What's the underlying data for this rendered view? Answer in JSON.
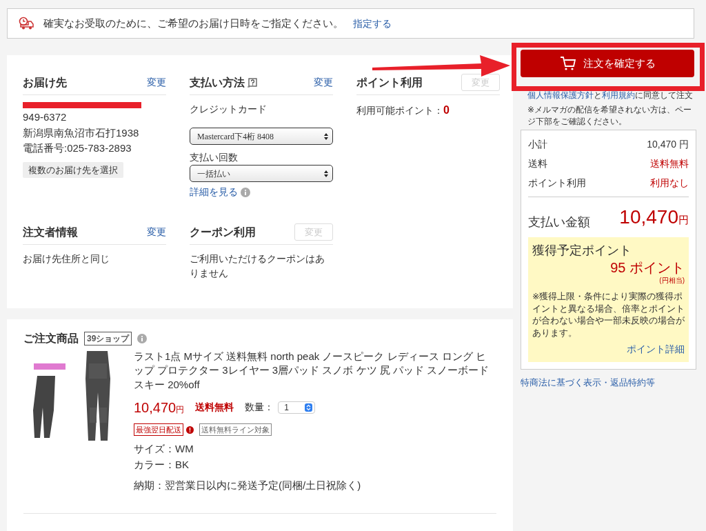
{
  "banner": {
    "text": "確実なお受取のために、ご希望のお届け日時をご指定ください。",
    "link": "指定する"
  },
  "sections": [
    {
      "kind": "address",
      "title": "お届け先",
      "change": {
        "label": "変更",
        "disabled": false
      },
      "lines": [
        "949-6372",
        "新潟県南魚沼市石打1938",
        "電話番号:025-783-2893"
      ],
      "button": "複数のお届け先を選択"
    },
    {
      "kind": "payment",
      "title": "支払い方法",
      "change": {
        "label": "変更",
        "disabled": false
      },
      "method": "クレジットカード",
      "card": "Mastercard下4桁 8408",
      "installments_label": "支払い回数",
      "installments": "一括払い",
      "details_link": "詳細を見る"
    },
    {
      "kind": "points",
      "title": "ポイント利用",
      "change": {
        "label": "変更",
        "disabled": true
      },
      "label": "利用可能ポイント：",
      "value": "0"
    },
    {
      "kind": "text",
      "title": "注文者情報",
      "change": {
        "label": "変更",
        "disabled": false
      },
      "text": "お届け先住所と同じ"
    },
    {
      "kind": "text",
      "title": "クーポン利用",
      "change": {
        "label": "変更",
        "disabled": true
      },
      "text": "ご利用いただけるクーポンはありません"
    }
  ],
  "order": {
    "title": "ご注文商品",
    "shop": "39ショップ",
    "product": {
      "name": "ラスト1点 Mサイズ 送料無料 north peak ノースピーク レディース ロング ヒップ プロテクター 3レイヤー 3層パッド スノボ ケツ 尻 パッド スノーボードスキー 20%off",
      "price": "10,470",
      "yen": "円",
      "shipping": "送料無料",
      "qty_label": "数量：",
      "qty": "1",
      "tags": [
        {
          "label": "最強翌日配送",
          "kind": "red"
        },
        {
          "label": "送料無料ライン対象",
          "kind": "gray"
        }
      ],
      "attributes": [
        "サイズ：WM",
        "カラー：BK"
      ],
      "delivery": "納期：翌営業日以内に発送予定(同梱/土日祝除く)"
    }
  },
  "side": {
    "confirm": "注文を確定する",
    "agreement": [
      {
        "text": "個人情報保護方針",
        "link": true
      },
      {
        "text": "と",
        "link": false
      },
      {
        "text": "利用規約",
        "link": true
      },
      {
        "text": "に同意して注文",
        "link": false
      }
    ],
    "note": "※メルマガの配信を希望されない方は、ページ下部をご確認ください。",
    "summary": [
      {
        "label": "小計",
        "value": "10,470 円",
        "red": false
      },
      {
        "label": "送料",
        "value": "送料無料",
        "red": true
      },
      {
        "label": "ポイント利用",
        "value": "利用なし",
        "red": true
      }
    ],
    "total": {
      "label": "支払い金額",
      "value": "10,470",
      "yen": "円"
    },
    "points": {
      "title": "獲得予定ポイント",
      "value": "95 ポイント",
      "sub": "(円相当)",
      "note": "※獲得上限・条件により実際の獲得ポイントと異なる場合、倍率とポイントが合わない場合や一部未反映の場合があります。",
      "link": "ポイント詳細"
    },
    "footer_link": "特商法に基づく表示・返品特約等"
  }
}
